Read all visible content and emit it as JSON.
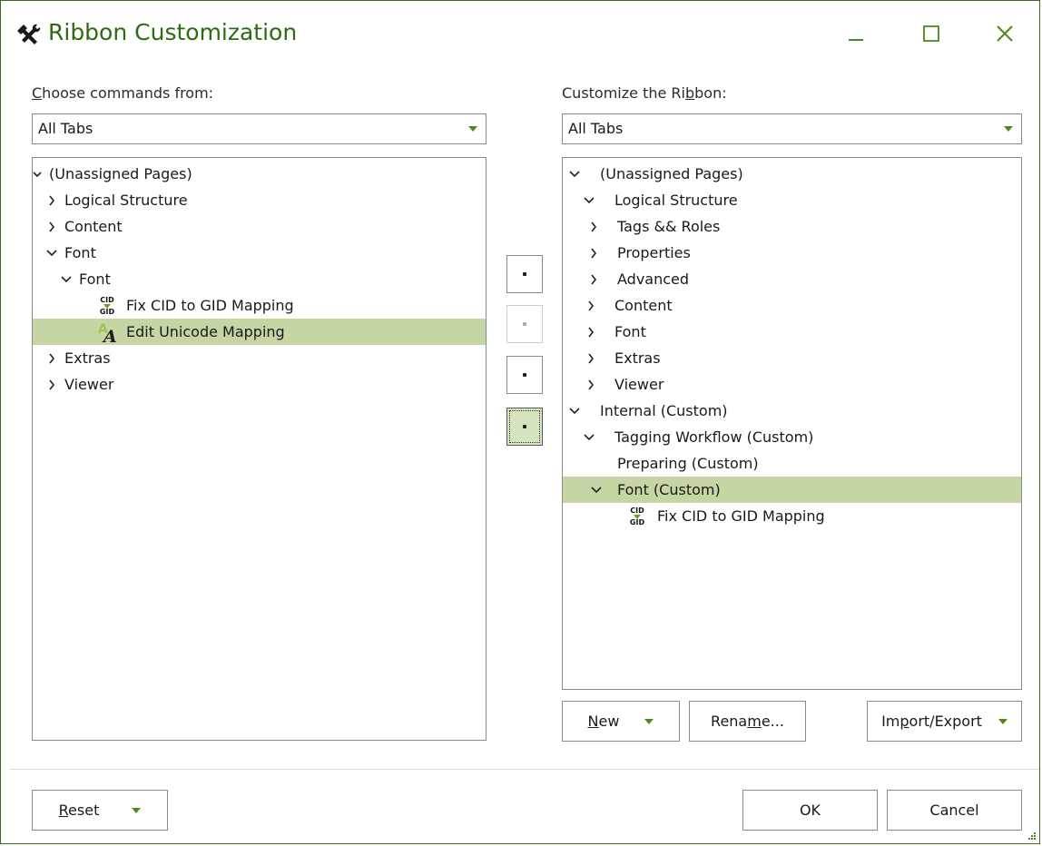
{
  "window": {
    "title": "Ribbon Customization",
    "icon": "tools-icon",
    "accent": "#4d8a1e",
    "selection_color": "#c5d5a4"
  },
  "left": {
    "label_mnemonic": "C",
    "label_rest": "hoose commands from:",
    "combo_value": "All Tabs",
    "tree": [
      {
        "text": "(Unassigned Pages)",
        "expanded": true
      },
      {
        "text": "Logical Structure",
        "expanded": false
      },
      {
        "text": "Content",
        "expanded": false
      },
      {
        "text": "Font",
        "expanded": true
      },
      {
        "text": "Font",
        "expanded": true
      },
      {
        "text": "Fix CID to GID Mapping",
        "icon": "cid-gid-icon"
      },
      {
        "text": "Edit Unicode Mapping",
        "icon": "unicode-a-icon",
        "selected": true
      },
      {
        "text": "Extras",
        "expanded": false
      },
      {
        "text": "Viewer",
        "expanded": false
      }
    ]
  },
  "right": {
    "label_pre": "Customize the Ri",
    "label_mnemonic": "b",
    "label_post": "bon:",
    "combo_value": "All Tabs",
    "tree": [
      {
        "text": "(Unassigned Pages)",
        "expanded": true
      },
      {
        "text": "Logical Structure",
        "expanded": true
      },
      {
        "text": "Tags && Roles",
        "expanded": false
      },
      {
        "text": "Properties",
        "expanded": false
      },
      {
        "text": "Advanced",
        "expanded": false
      },
      {
        "text": "Content",
        "expanded": false
      },
      {
        "text": "Font",
        "expanded": false
      },
      {
        "text": "Extras",
        "expanded": false
      },
      {
        "text": "Viewer",
        "expanded": false
      },
      {
        "text": "Internal (Custom)",
        "expanded": true
      },
      {
        "text": "Tagging Workflow (Custom)",
        "expanded": true
      },
      {
        "text": "Preparing (Custom)"
      },
      {
        "text": "Font (Custom)",
        "expanded": true,
        "selected": true
      },
      {
        "text": "Fix CID to GID Mapping",
        "icon": "cid-gid-icon"
      }
    ],
    "new_button": {
      "mnemonic": "N",
      "rest": "ew"
    },
    "rename_button": {
      "pre": "Rena",
      "mnemonic": "m",
      "post": "e..."
    },
    "import_export_button": {
      "pre": "Im",
      "mnemonic": "p",
      "post": "ort/Export"
    }
  },
  "footer": {
    "reset_button": {
      "mnemonic": "R",
      "rest": "eset"
    },
    "ok_label": "OK",
    "cancel_label": "Cancel"
  }
}
